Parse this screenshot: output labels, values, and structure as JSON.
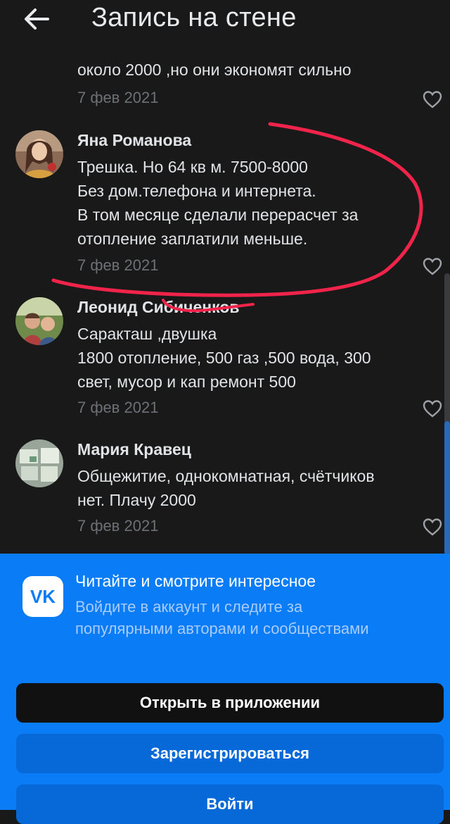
{
  "header": {
    "title": "Запись на стене",
    "back_icon": "arrow-left-icon"
  },
  "previous_comment": {
    "tail_text": "около 2000 ,но они экономят сильно",
    "date": "7 фев 2021"
  },
  "comments": [
    {
      "author": "Яна Романова",
      "lines": [
        "Трешка. Но 64 кв м. 7500-8000",
        "Без дом.телефона и интернета.",
        "В том месяце сделали перерасчет за",
        "отопление заплатили меньше."
      ],
      "date": "7 фев 2021"
    },
    {
      "author": "Леонид Сибиченков",
      "lines": [
        "Саракташ ,двушка",
        "1800 отопление, 500 газ ,500 вода, 300",
        "свет, мусор и кап ремонт 500"
      ],
      "date": "7 фев 2021"
    },
    {
      "author": "Мария Кравец",
      "lines": [
        "Общежитие, однокомнатная, счётчиков",
        "нет. Плачу 2000"
      ],
      "date": "7 фев 2021"
    }
  ],
  "promo": {
    "title": "Читайте и смотрите интересное",
    "subtitle": "Войдите в аккаунт и следите за популярными авторами и сообществами",
    "logo_text": "VK",
    "buttons": {
      "open_app": "Открыть в приложении",
      "register": "Зарегистрироваться",
      "login": "Войти"
    }
  },
  "colors": {
    "background": "#19191a",
    "promo_blue": "#0a7cf6",
    "annotation_red": "#f0244a"
  }
}
